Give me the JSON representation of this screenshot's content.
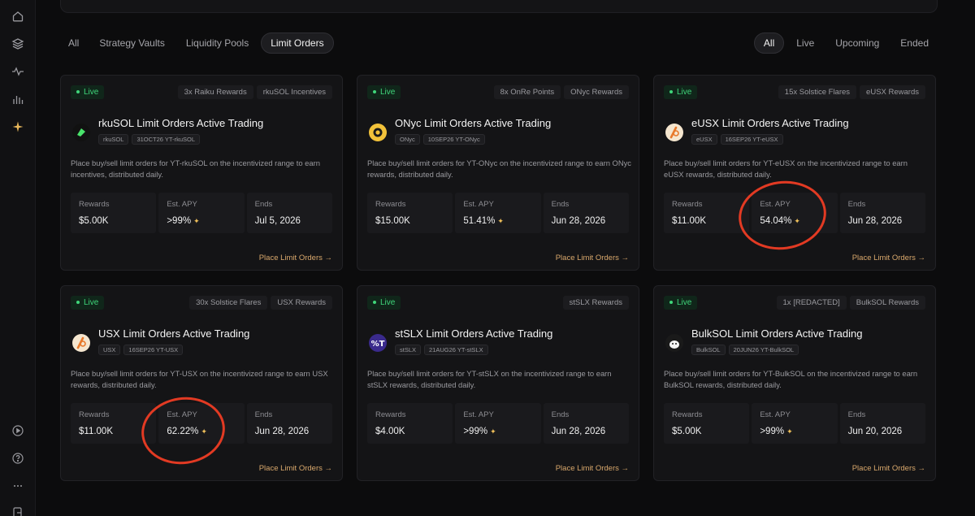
{
  "sidebar": {
    "icons": [
      "home-icon",
      "layers-icon",
      "activity-icon",
      "bar-chart-icon",
      "sparkle-icon",
      "play-circle-icon",
      "help-circle-icon",
      "more-icon",
      "logout-icon"
    ]
  },
  "filters": {
    "category": [
      "All",
      "Strategy Vaults",
      "Liquidity Pools",
      "Limit Orders"
    ],
    "category_active": "Limit Orders",
    "status": [
      "All",
      "Live",
      "Upcoming",
      "Ended"
    ],
    "status_active": "All"
  },
  "cards": [
    {
      "status": "Live",
      "rewards": [
        "3x Raiku Rewards",
        "rkuSOL Incentives"
      ],
      "title": "rkuSOL Limit Orders Active Trading",
      "tags": [
        "rkuSOL",
        "31OCT26 YT-rkuSOL"
      ],
      "description": "Place buy/sell limit orders for YT-rkuSOL on the incentivized range to earn incentives, distributed daily.",
      "rewards_label": "Rewards",
      "rewards_value": "$5.00K",
      "apy_label": "Est. APY",
      "apy_value": ">99%",
      "ends_label": "Ends",
      "ends_value": "Jul 5, 2026",
      "link": "Place Limit Orders →",
      "logo_color": "#111111",
      "logo_accent": "#49e36b"
    },
    {
      "status": "Live",
      "rewards": [
        "8x OnRe Points",
        "ONyc Rewards"
      ],
      "title": "ONyc Limit Orders Active Trading",
      "tags": [
        "ONyc",
        "10SEP26 YT-ONyc"
      ],
      "description": "Place buy/sell limit orders for YT-ONyc on the incentivized range to earn ONyc rewards, distributed daily.",
      "rewards_label": "Rewards",
      "rewards_value": "$15.00K",
      "apy_label": "Est. APY",
      "apy_value": "51.41%",
      "ends_label": "Ends",
      "ends_value": "Jun 28, 2026",
      "link": "Place Limit Orders →",
      "logo_color": "#f2c23a",
      "logo_accent": "#1a1a1a"
    },
    {
      "status": "Live",
      "rewards": [
        "15x Solstice Flares",
        "eUSX Rewards"
      ],
      "title": "eUSX Limit Orders Active Trading",
      "tags": [
        "eUSX",
        "16SEP26 YT-eUSX"
      ],
      "description": "Place buy/sell limit orders for YT-eUSX on the incentivized range to earn eUSX rewards, distributed daily.",
      "rewards_label": "Rewards",
      "rewards_value": "$11.00K",
      "apy_label": "Est. APY",
      "apy_value": "54.04%",
      "ends_label": "Ends",
      "ends_value": "Jun 28, 2026",
      "link": "Place Limit Orders →",
      "logo_color": "#f5e6cf",
      "logo_accent": "#e8792b"
    },
    {
      "status": "Live",
      "rewards": [
        "30x Solstice Flares",
        "USX Rewards"
      ],
      "title": "USX Limit Orders Active Trading",
      "tags": [
        "USX",
        "16SEP26 YT-USX"
      ],
      "description": "Place buy/sell limit orders for YT-USX on the incentivized range to earn USX rewards, distributed daily.",
      "rewards_label": "Rewards",
      "rewards_value": "$11.00K",
      "apy_label": "Est. APY",
      "apy_value": "62.22%",
      "ends_label": "Ends",
      "ends_value": "Jun 28, 2026",
      "link": "Place Limit Orders →",
      "logo_color": "#f5e6cf",
      "logo_accent": "#e8792b"
    },
    {
      "status": "Live",
      "rewards": [
        "stSLX Rewards"
      ],
      "title": "stSLX Limit Orders Active Trading",
      "tags": [
        "stSLX",
        "21AUG26 YT-stSLX"
      ],
      "description": "Place buy/sell limit orders for YT-stSLX on the incentivized range to earn stSLX rewards, distributed daily.",
      "rewards_label": "Rewards",
      "rewards_value": "$4.00K",
      "apy_label": "Est. APY",
      "apy_value": ">99%",
      "ends_label": "Ends",
      "ends_value": "Jun 28, 2026",
      "link": "Place Limit Orders →",
      "logo_color": "#3a2a8c",
      "logo_accent": "#ffffff"
    },
    {
      "status": "Live",
      "rewards": [
        "1x [REDACTED]",
        "BulkSOL Rewards"
      ],
      "title": "BulkSOL Limit Orders Active Trading",
      "tags": [
        "BulkSOL",
        "20JUN26 YT-BulkSOL"
      ],
      "description": "Place buy/sell limit orders for YT-BulkSOL on the incentivized range to earn BulkSOL rewards, distributed daily.",
      "rewards_label": "Rewards",
      "rewards_value": "$5.00K",
      "apy_label": "Est. APY",
      "apy_value": ">99%",
      "ends_label": "Ends",
      "ends_value": "Jun 20, 2026",
      "link": "Place Limit Orders →",
      "logo_color": "#1a1a1a",
      "logo_accent": "#f4f4f4"
    }
  ]
}
